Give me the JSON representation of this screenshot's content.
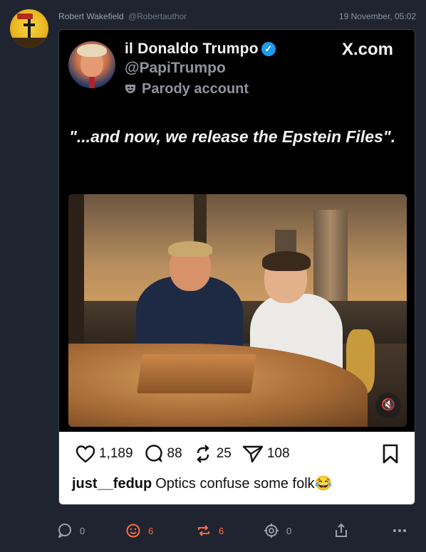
{
  "post": {
    "author_name": "Robert Wakefield",
    "author_handle": "@Robertauthor",
    "timestamp": "19 November, 05:02"
  },
  "embed": {
    "display_name": "il Donaldo Trumpo",
    "handle": "@PapiTrumpo",
    "parody_label": "Parody account",
    "brand": "X.com",
    "quote": "\"...and now, we release the Epstein Files\".",
    "stats": {
      "likes": "1,189",
      "replies": "88",
      "reposts": "25",
      "shares": "108"
    },
    "comment_user": "just__fedup",
    "comment_text": "Optics confuse some folk😂"
  },
  "actions": {
    "replies": "0",
    "reactions": "6",
    "boosts": "6",
    "quotes": "0"
  },
  "colors": {
    "background": "#1f2430",
    "accent": "#ff6b3d",
    "verified": "#1d9bf0"
  }
}
